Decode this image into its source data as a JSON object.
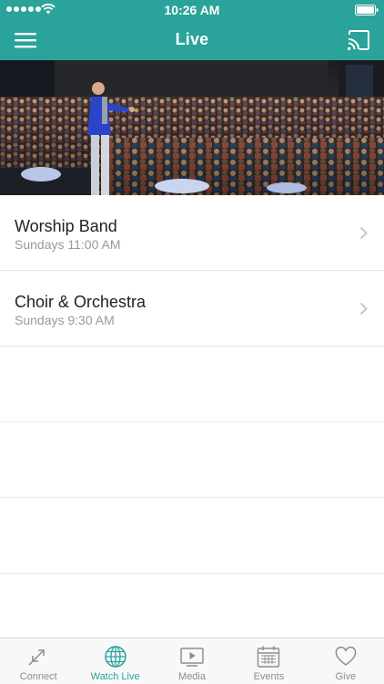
{
  "status_bar": {
    "time": "10:26 AM"
  },
  "nav": {
    "title": "Live",
    "menu_icon": "hamburger-menu-icon",
    "cast_icon": "cast-icon"
  },
  "hero": {
    "description_icon": "live-stage-photo"
  },
  "streams": [
    {
      "title": "Worship Band",
      "schedule": "Sundays 11:00 AM"
    },
    {
      "title": "Choir & Orchestra",
      "schedule": "Sundays 9:30 AM"
    }
  ],
  "tabs": [
    {
      "label": "Connect",
      "icon": "connect-arrows-icon",
      "active": false
    },
    {
      "label": "Watch Live",
      "icon": "globe-icon",
      "active": true
    },
    {
      "label": "Media",
      "icon": "video-play-icon",
      "active": false
    },
    {
      "label": "Events",
      "icon": "calendar-icon",
      "active": false
    },
    {
      "label": "Give",
      "icon": "heart-icon",
      "active": false
    }
  ],
  "colors": {
    "brand": "#2aa39a",
    "tab_inactive": "#8e8e8e",
    "subtitle": "#9a9a9a"
  }
}
